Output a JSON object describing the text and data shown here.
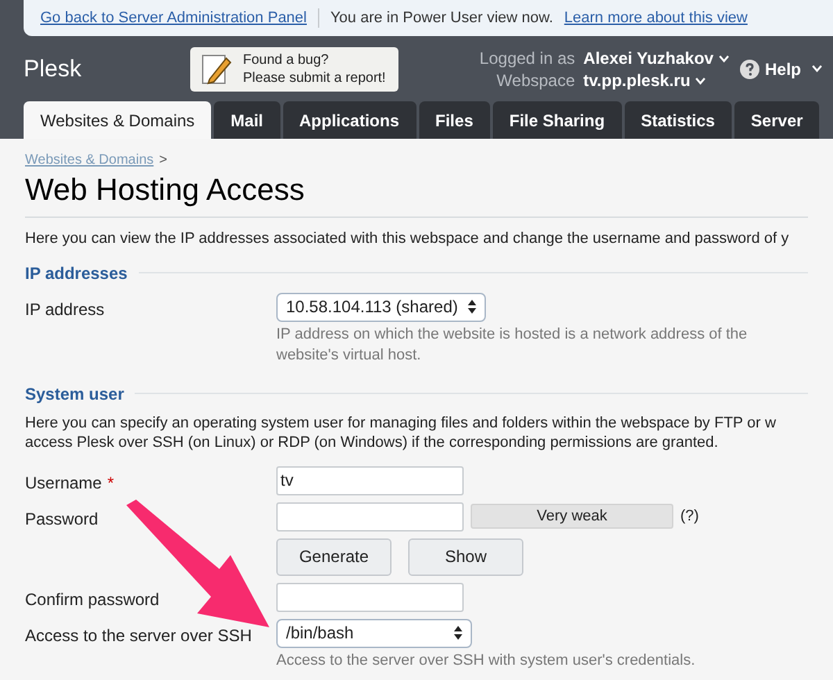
{
  "notice_bar": {
    "back_link": "Go back to Server Administration Panel",
    "message": "You are in Power User view now.",
    "learn_link": "Learn more about this view"
  },
  "header": {
    "logo": "Plesk",
    "bug_report": {
      "line1": "Found a bug?",
      "line2": "Please submit a report!"
    },
    "logged_in_label": "Logged in as",
    "user": "Alexei Yuzhakov",
    "webspace_label": "Webspace",
    "webspace": "tv.pp.plesk.ru",
    "help": "Help"
  },
  "tabs": [
    {
      "label": "Websites & Domains",
      "selected": true
    },
    {
      "label": "Mail",
      "selected": false
    },
    {
      "label": "Applications",
      "selected": false
    },
    {
      "label": "Files",
      "selected": false
    },
    {
      "label": "File Sharing",
      "selected": false
    },
    {
      "label": "Statistics",
      "selected": false
    },
    {
      "label": "Server",
      "selected": false
    }
  ],
  "breadcrumb": {
    "link": "Websites & Domains",
    "separator": ">"
  },
  "title": "Web Hosting Access",
  "intro": "Here you can view the IP addresses associated with this webspace and change the username and password of y",
  "sections": [
    {
      "heading": "IP addresses",
      "fields": [
        {
          "kind": "select",
          "label": "IP address",
          "value": "10.58.104.113 (shared)",
          "hint": "IP address on which the website is hosted is a network address of the website's virtual host."
        }
      ]
    },
    {
      "heading": "System user",
      "description": "Here you can specify an operating system user for managing files and folders within the webspace by FTP or w\naccess Plesk over SSH (on Linux) or RDP (on Windows) if the corresponding permissions are granted.",
      "fields": [
        {
          "kind": "text",
          "label": "Username",
          "required_mark": "*",
          "value": "tv"
        },
        {
          "kind": "password",
          "label": "Password",
          "strength": "Very weak",
          "help_mark": "(?)"
        },
        {
          "kind": "buttons",
          "buttons": [
            "Generate",
            "Show"
          ]
        },
        {
          "kind": "text",
          "label": "Confirm password"
        },
        {
          "kind": "select",
          "label": "Access to the server over SSH",
          "value": "/bin/bash",
          "hint": "Access to the server over SSH with system user's credentials."
        }
      ]
    }
  ]
}
